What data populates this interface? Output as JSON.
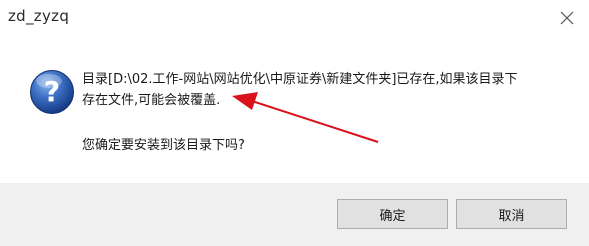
{
  "window": {
    "title": "zd_zyzq"
  },
  "message": {
    "line1": "目录[D:\\02.工作-网站\\网站优化\\中原证券\\新建文件夹]已存在,如果该目录下",
    "line2": "存在文件,可能会被覆盖.",
    "confirm": "您确定要安装到该目录下吗?"
  },
  "buttons": {
    "ok_label": "确定",
    "cancel_label": "取消"
  },
  "icons": {
    "close": "close-icon",
    "question": "question-icon",
    "annotation": "red-arrow-annotation"
  },
  "colors": {
    "arrow": "#d9121b",
    "icon_blue": "#1f4fa3"
  }
}
